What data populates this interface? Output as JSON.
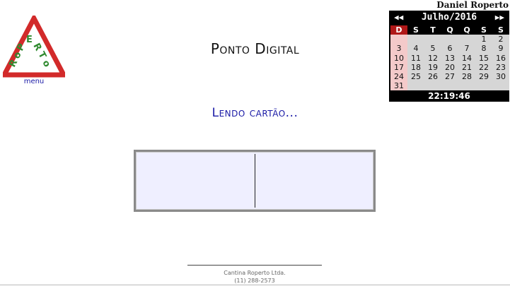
{
  "logo": {
    "text": "ROPERTO",
    "color_red": "#d22a2a",
    "color_green": "#2f8a2f"
  },
  "menu_label": "menu",
  "title": "Ponto Digital",
  "status": "Lendo cartão...",
  "user": {
    "name": "Daniel Roperto"
  },
  "calendar": {
    "month_label": "Julho/2016",
    "prev_icon": "previous-month-icon",
    "next_icon": "next-month-icon",
    "weekdays": [
      "D",
      "S",
      "T",
      "Q",
      "Q",
      "S",
      "S"
    ],
    "weeks": [
      [
        "",
        "",
        "",
        "",
        "",
        "1",
        "2"
      ],
      [
        "3",
        "4",
        "5",
        "6",
        "7",
        "8",
        "9"
      ],
      [
        "10",
        "11",
        "12",
        "13",
        "14",
        "15",
        "16"
      ],
      [
        "17",
        "18",
        "19",
        "20",
        "21",
        "22",
        "23"
      ],
      [
        "24",
        "25",
        "26",
        "27",
        "28",
        "29",
        "30"
      ],
      [
        "31",
        "",
        "",
        "",
        "",
        "",
        ""
      ]
    ]
  },
  "clock": "22:19:46",
  "footer": {
    "company": "Cantina Roperto Ltda.",
    "phone": "(11) 288-2573"
  }
}
